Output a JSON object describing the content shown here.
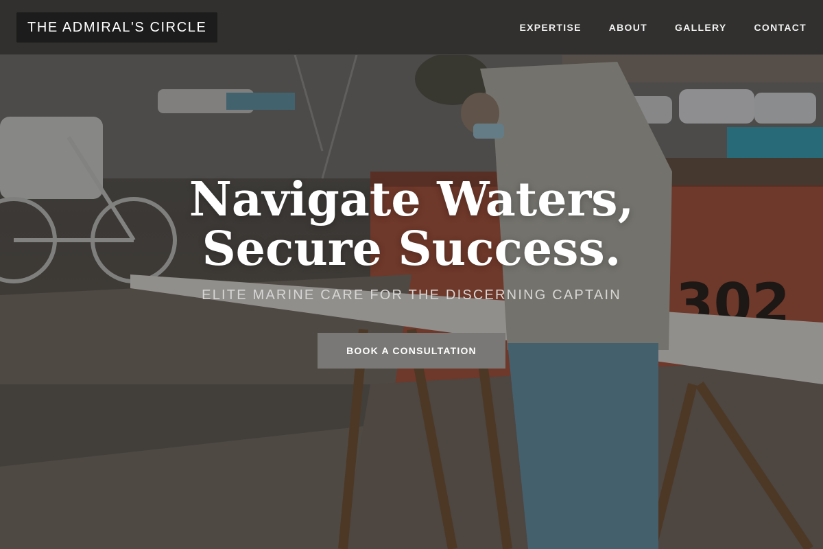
{
  "header": {
    "logo_text": "THE ADMIRAL'S CIRCLE",
    "nav": [
      {
        "label": "EXPERTISE"
      },
      {
        "label": "ABOUT"
      },
      {
        "label": "GALLERY"
      },
      {
        "label": "CONTACT"
      }
    ]
  },
  "hero": {
    "headline": "Navigate Waters, Secure Success.",
    "subtitle": "ELITE MARINE CARE FOR THE DISCERNING CAPTAIN",
    "cta_label": "BOOK A CONSULTATION",
    "background_image": "photo of a worker cutting wooden planks on sawhorses at a marina, boats and a bicycle in background"
  },
  "colors": {
    "header_bg": "#302f2e",
    "logo_bg": "#1c1c1c",
    "cta_bg": "#7a7876",
    "text_primary": "#ffffff",
    "text_muted": "#d8d6d4"
  }
}
